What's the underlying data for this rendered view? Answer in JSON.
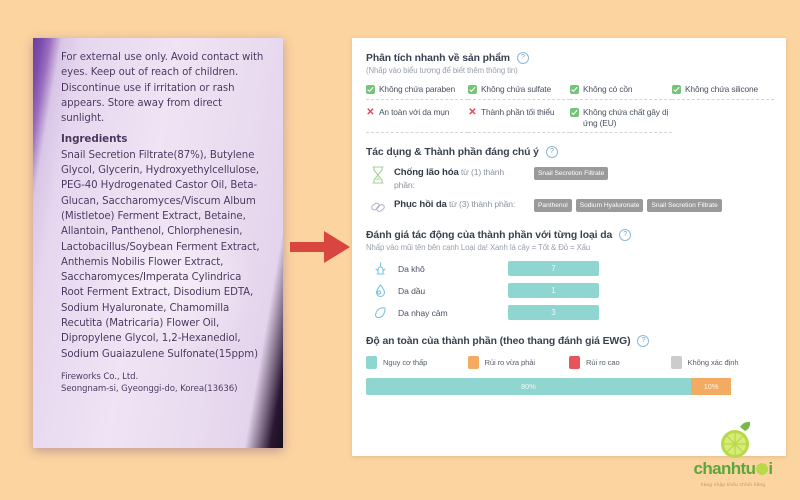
{
  "background_color": "#fbd4a0",
  "product_label": {
    "warning": "For external use only. Avoid contact with eyes. Keep out of reach of children. Discontinue use if irritation or rash appears. Store away from direct sunlight.",
    "ingredients_heading": "Ingredients",
    "ingredients_body": "Snail Secretion Filtrate(87%), Butylene Glycol, Glycerin, Hydroxyethylcellulose, PEG-40 Hydrogenated Castor Oil, Beta-Glucan, Saccharomyces/Viscum Album (Mistletoe) Ferment Extract, Betaine, Allantoin, Panthenol, Chlorphenesin, Lactobacillus/Soybean Ferment Extract, Anthemis Nobilis Flower Extract, Saccharomyces/Imperata Cylindrica Root Ferment Extract, Disodium EDTA, Sodium Hyaluronate, Chamomilla Recutita (Matricaria) Flower Oil, Dipropylene Glycol, 1,2-Hexanediol, Sodium Guaiazulene Sulfonate(15ppm)",
    "manufacturer": "Fireworks Co., Ltd.",
    "manufacturer_address": "Seongnam-si, Gyeonggi-do, Korea(13636)"
  },
  "arrow": {
    "icon": "arrow-right-icon",
    "color": "#d9453f"
  },
  "quick_analysis": {
    "title": "Phân tích nhanh về sản phẩm",
    "subtitle": "(Nhấp vào biểu tượng để biết thêm thông tin)",
    "help_icon": "help-circle-icon",
    "chips": [
      {
        "label": "Không chứa paraben",
        "status": "ok",
        "icon": "check-square-icon"
      },
      {
        "label": "Không chứa sulfate",
        "status": "ok",
        "icon": "check-square-icon"
      },
      {
        "label": "Không có cồn",
        "status": "ok",
        "icon": "check-square-icon"
      },
      {
        "label": "Không chứa silicone",
        "status": "ok",
        "icon": "check-square-icon"
      },
      {
        "label": "An toàn với da mụn",
        "status": "no",
        "icon": "cross-icon"
      },
      {
        "label": "Thành phần tối thiểu",
        "status": "no",
        "icon": "cross-icon"
      },
      {
        "label": "Không chứa chất gây dị ứng (EU)",
        "status": "ok",
        "icon": "check-square-icon"
      }
    ]
  },
  "effects": {
    "title": "Tác dụng & Thành phần đáng chú ý",
    "help_icon": "help-circle-icon",
    "rows": [
      {
        "icon": "hourglass-icon",
        "name": "Chống lão hóa",
        "count_text": "từ (1) thành phần:",
        "tags": [
          "Snail Secretion Filtrate"
        ]
      },
      {
        "icon": "bandage-icon",
        "name": "Phục hồi da",
        "count_text": "từ (3) thành phần:",
        "tags": [
          "Panthenol",
          "Sodium Hyaluronate",
          "Snail Secretion Filtrate"
        ]
      }
    ]
  },
  "skin_impact": {
    "title": "Đánh giá tác động của thành phần với từng loại da",
    "subtitle": "Nhấp vào mũi tên bên cạnh Loại da! Xanh lá cây = Tốt & Đỏ = Xấu",
    "help_icon": "help-circle-icon",
    "bar_color": "#8fd6d0",
    "rows": [
      {
        "icon": "dry-skin-icon",
        "label": "Da khô",
        "value": "7"
      },
      {
        "icon": "oily-skin-icon",
        "label": "Da dầu",
        "value": "1"
      },
      {
        "icon": "sensitive-skin-icon",
        "label": "Da nhạy cảm",
        "value": "3"
      }
    ]
  },
  "ewg": {
    "title": "Độ an toàn của thành phần (theo thang đánh giá EWG)",
    "help_icon": "help-circle-icon",
    "legend": [
      {
        "label": "Nguy cơ thấp",
        "color": "#8fd6d0"
      },
      {
        "label": "Rủi ro vừa phải",
        "color": "#f3ab62"
      },
      {
        "label": "Rủi ro cao",
        "color": "#e8545c"
      },
      {
        "label": "Không xác định",
        "color": "#cccccc"
      }
    ],
    "chart_data": {
      "type": "bar",
      "orientation": "horizontal-stacked",
      "title": "Độ an toàn của thành phần (theo thang đánh giá EWG)",
      "categories": [
        "Nguy cơ thấp",
        "Rủi ro vừa phải"
      ],
      "values": [
        80,
        10
      ],
      "labels": [
        "80%",
        "10%"
      ],
      "colors": [
        "#8fd6d0",
        "#f3ab62"
      ],
      "total": 100,
      "unit": "%"
    }
  },
  "brand": {
    "name_part1": "chanhtu",
    "name_part2": "i",
    "lime_icon": "lime-fruit-icon",
    "tagline": "hàng nhập khẩu chính hãng"
  }
}
